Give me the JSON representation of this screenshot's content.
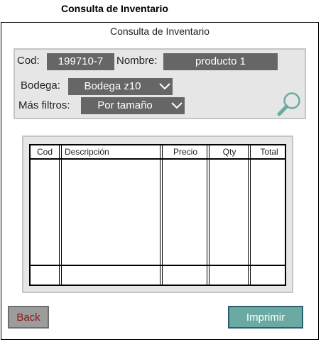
{
  "page_title": "Consulta de Inventario",
  "form": {
    "title": "Consulta de Inventario",
    "cod_label": "Cod:",
    "cod_value": "199710-7",
    "nombre_label": "Nombre:",
    "nombre_value": "producto 1",
    "bodega_label": "Bodega:",
    "bodega_value": "Bodega z10",
    "filtros_label": "Más filtros:",
    "filtros_value": "Por tamaño",
    "search_icon": "magnifier-icon"
  },
  "table": {
    "columns": [
      "Cod",
      "Descripción",
      "Precio",
      "Qty",
      "Total"
    ]
  },
  "buttons": {
    "back": "Back",
    "print": "Imprimir"
  },
  "colors": {
    "field_bg": "#666666",
    "panel_bg": "#e6e6e6",
    "print_bg": "#6aaaa2",
    "back_text": "#8a1818"
  }
}
